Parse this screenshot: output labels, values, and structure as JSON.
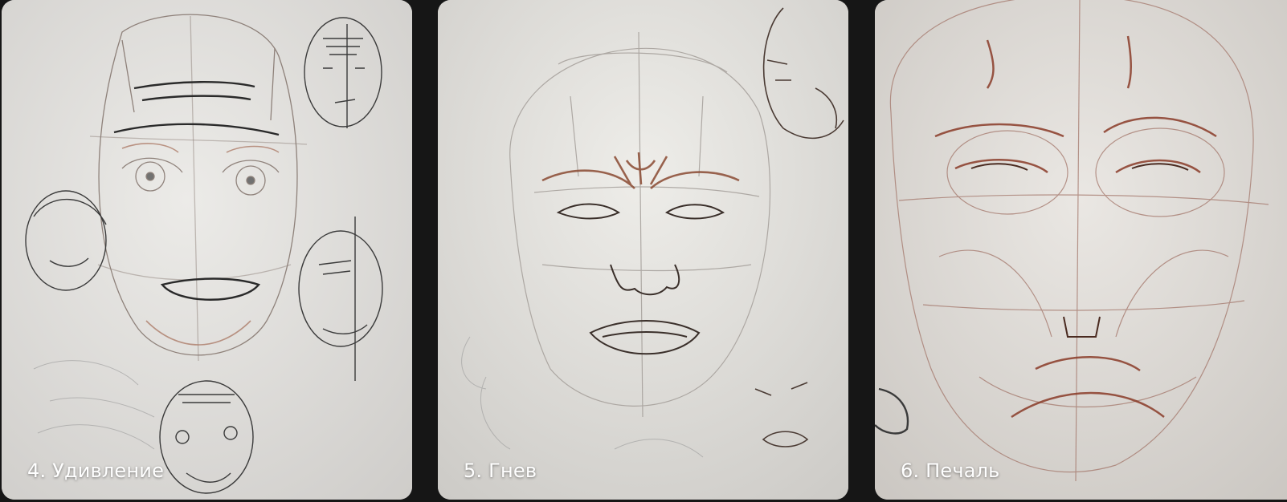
{
  "gallery": {
    "cards": [
      {
        "caption": "4. Удивление",
        "image_name": "surprise-face-sketch"
      },
      {
        "caption": "5. Гнев",
        "image_name": "anger-face-sketch"
      },
      {
        "caption": "6. Печаль",
        "image_name": "sadness-face-sketch"
      }
    ]
  }
}
